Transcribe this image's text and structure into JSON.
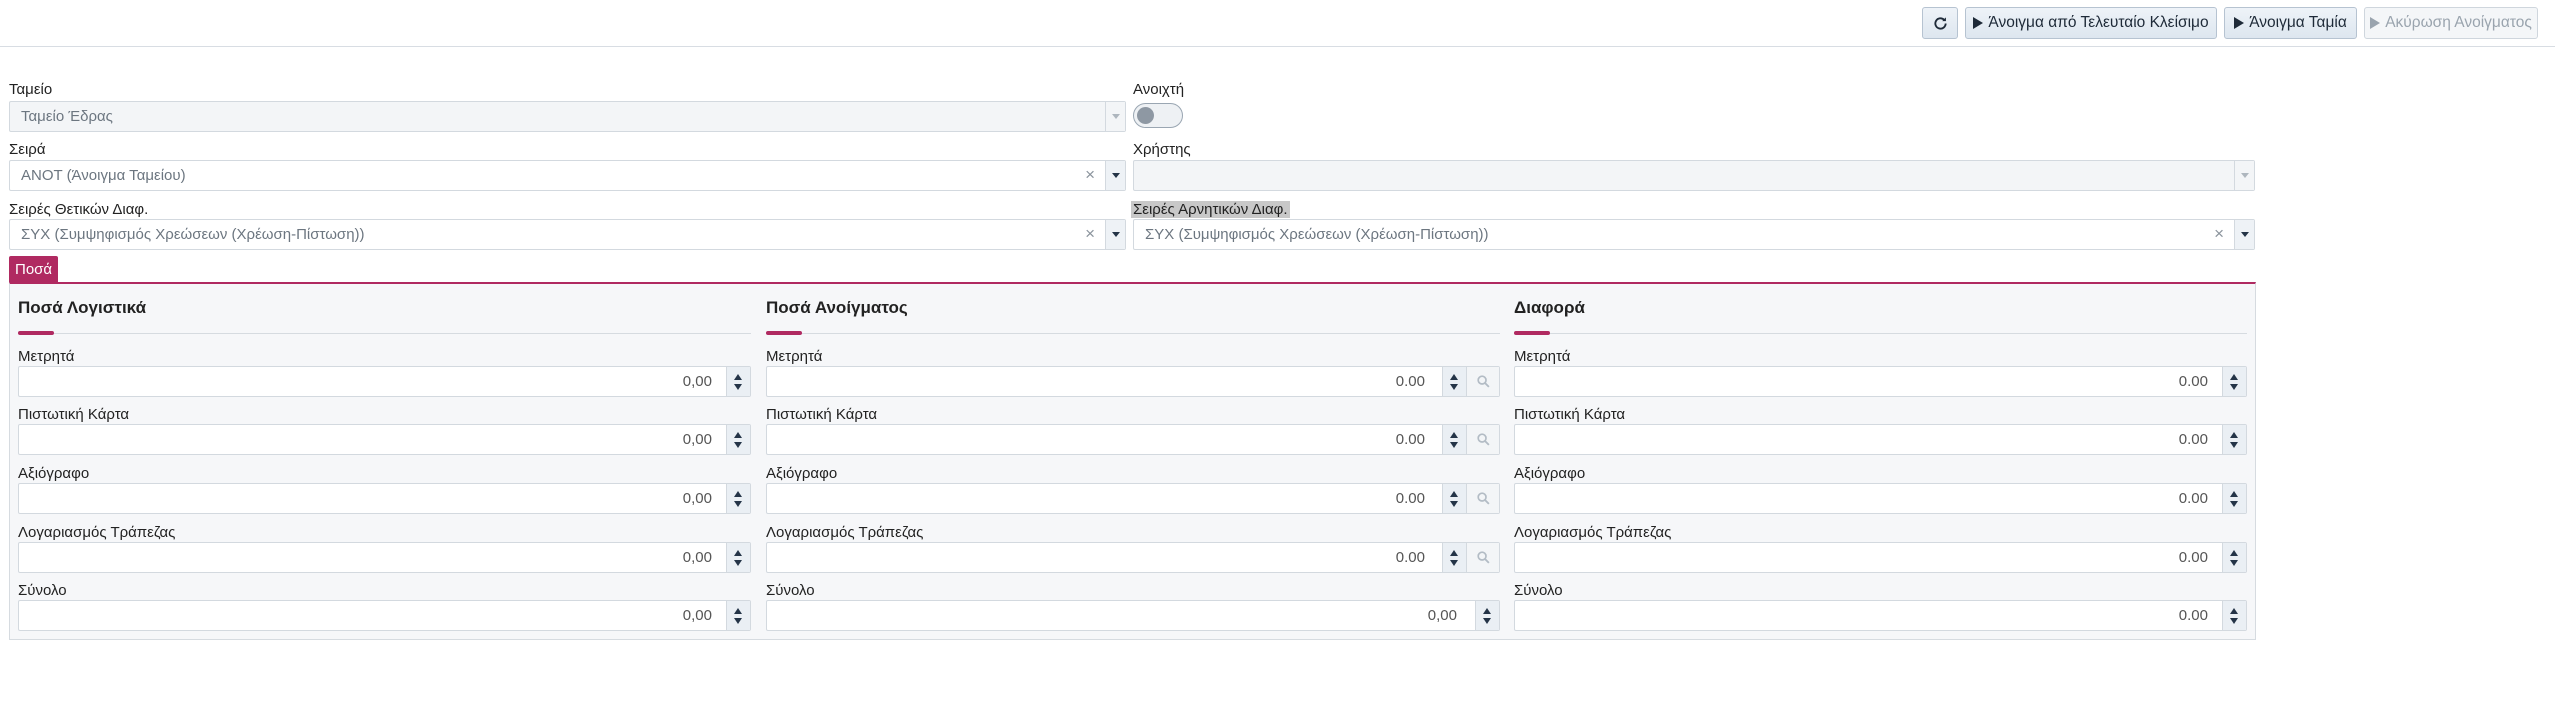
{
  "toolbar": {
    "refresh_icon": "refresh-icon",
    "open_from_last_close": "Άνοιγμα από Τελευταίο Κλείσιμο",
    "open_cash": "Άνοιγμα Ταμία",
    "cancel_openings": "Ακύρωση Ανοίγματος"
  },
  "form": {
    "cash_register_label": "Ταμείο",
    "cash_register_value": "Ταμείο Έδρας",
    "open_label": "Ανοιχτή",
    "open_value": false,
    "series_label": "Σειρά",
    "series_value": "ΑΝΟΤ (Άνοιγμα Ταμείου)",
    "user_label": "Χρήστης",
    "user_value": "",
    "pos_diff_label": "Σειρές Θετικών Διαφ.",
    "pos_diff_value": "ΣΥΧ (Συμψηφισμός Χρεώσεων (Χρέωση-Πίστωση))",
    "neg_diff_label": "Σειρές Αρνητικών Διαφ.",
    "neg_diff_value": "ΣΥΧ (Συμψηφισμός Χρεώσεων (Χρέωση-Πίστωση))"
  },
  "tabs": [
    {
      "label": "Ποσά"
    }
  ],
  "sections": [
    {
      "title": "Ποσά Λογιστικά",
      "fields": [
        {
          "label": "Μετρητά",
          "value": "0,00"
        },
        {
          "label": "Πιστωτική Κάρτα",
          "value": "0,00"
        },
        {
          "label": "Αξιόγραφο",
          "value": "0,00"
        },
        {
          "label": "Λογαριασμός Τράπεζας",
          "value": "0,00"
        },
        {
          "label": "Σύνολο",
          "value": "0,00"
        }
      ]
    },
    {
      "title": "Ποσά Ανοίγματος",
      "fields": [
        {
          "label": "Μετρητά",
          "value": "0.00"
        },
        {
          "label": "Πιστωτική Κάρτα",
          "value": "0.00"
        },
        {
          "label": "Αξιόγραφο",
          "value": "0.00"
        },
        {
          "label": "Λογαριασμός Τράπεζας",
          "value": "0.00"
        },
        {
          "label": "Σύνολο",
          "value": "0,00"
        }
      ]
    },
    {
      "title": "Διαφορά",
      "fields": [
        {
          "label": "Μετρητά",
          "value": "0.00"
        },
        {
          "label": "Πιστωτική Κάρτα",
          "value": "0.00"
        },
        {
          "label": "Αξιόγραφο",
          "value": "0.00"
        },
        {
          "label": "Λογαριασμός Τράπεζας",
          "value": "0.00"
        },
        {
          "label": "Σύνολο",
          "value": "0.00"
        }
      ]
    }
  ]
}
